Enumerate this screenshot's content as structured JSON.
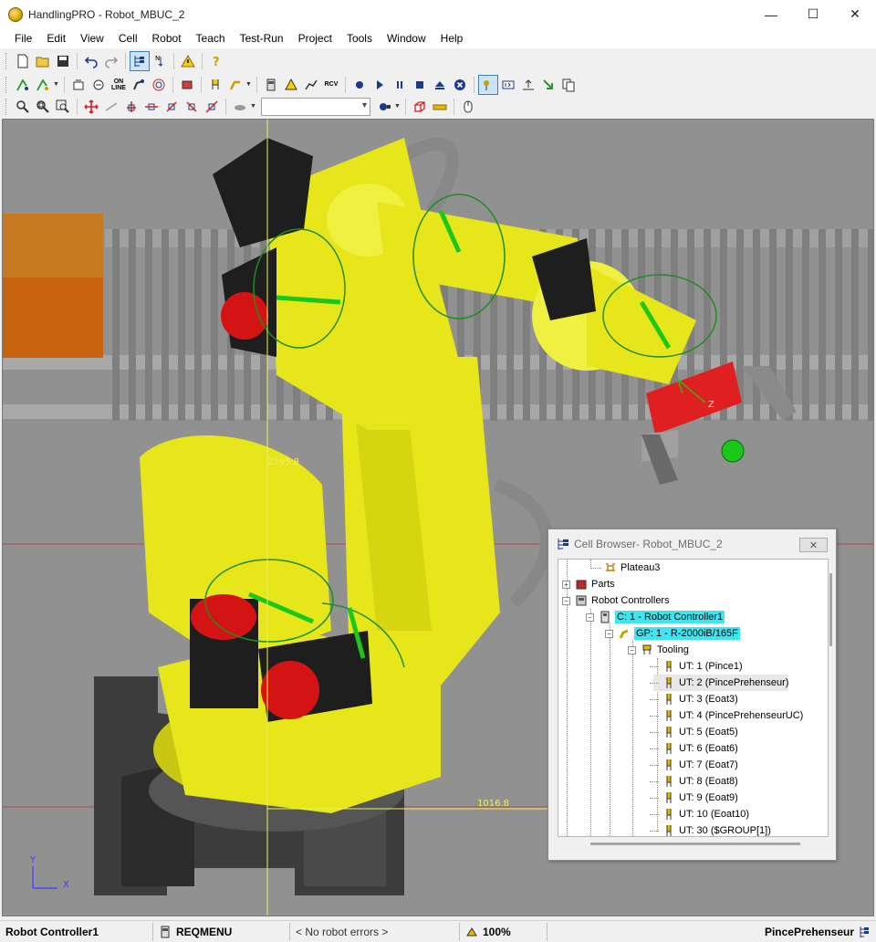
{
  "window": {
    "title": "HandlingPRO  -  Robot_MBUC_2",
    "app_icon": "handlingpro-icon",
    "minimize": "—",
    "maximize": "☐",
    "close": "✕"
  },
  "menu": [
    "File",
    "Edit",
    "View",
    "Cell",
    "Robot",
    "Teach",
    "Test-Run",
    "Project",
    "Tools",
    "Window",
    "Help"
  ],
  "toolbar": {
    "online_top": "ON",
    "online_bottom": "LINE",
    "rcv_label": "RCV",
    "combo_value": ""
  },
  "viewport": {
    "dim_vertical": "2195.8",
    "dim_horizontal": "1016.8",
    "axis_y": "Y",
    "axis_x": "X",
    "axis_z_tool": "Z",
    "colors": {
      "background": "#919191",
      "robot": "#e6e61a",
      "motor": "#1e1e1e",
      "motor_cap": "#d41414",
      "base": "#3c3c3c",
      "box": "#c8640f",
      "fence": "#9a9a9a",
      "target": "#19c819"
    }
  },
  "cell_browser": {
    "title": "Cell Browser- Robot_MBUC_2",
    "close_label": "✕",
    "items": {
      "plateau": "Plateau3",
      "parts": "Parts",
      "robot_controllers": "Robot Controllers",
      "controller": "C: 1 - Robot Controller1",
      "group": "GP: 1 - R-2000iB/165F",
      "tooling": "Tooling"
    },
    "tools": [
      "UT: 1  (Pince1)",
      "UT: 2  (PincePrehenseur)",
      "UT: 3  (Eoat3)",
      "UT: 4  (PincePrehenseurUC)",
      "UT: 5  (Eoat5)",
      "UT: 6  (Eoat6)",
      "UT: 7  (Eoat7)",
      "UT: 8  (Eoat8)",
      "UT: 9  (Eoat9)",
      "UT: 10  (Eoat10)",
      "UT: 30  ($GROUP[1])"
    ],
    "selected_tool_index": 1
  },
  "status": {
    "controller": "Robot Controller1",
    "menu": "REQMENU",
    "errors": "< No robot errors >",
    "speed": "100%",
    "tool": "PincePrehenseur"
  }
}
